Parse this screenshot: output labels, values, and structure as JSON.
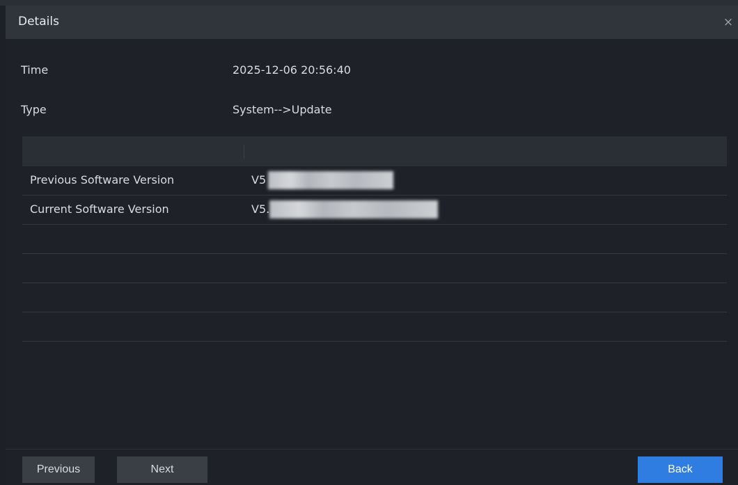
{
  "dialog": {
    "title": "Details",
    "close_glyph": "×"
  },
  "fields": [
    {
      "label": "Time",
      "value": "2025-12-06 20:56:40"
    },
    {
      "label": "Type",
      "value": "System-->Update"
    }
  ],
  "table": {
    "rows": [
      {
        "name": "Previous Software Version",
        "value": "V5"
      },
      {
        "name": "Current Software Version",
        "value": "V5."
      }
    ],
    "empty_rows": 4
  },
  "footer": {
    "previous_label": "Previous",
    "next_label": "Next",
    "back_label": "Back"
  },
  "colors": {
    "background": "#1d2127",
    "titlebar": "#30343b",
    "accent": "#2f7de0"
  }
}
